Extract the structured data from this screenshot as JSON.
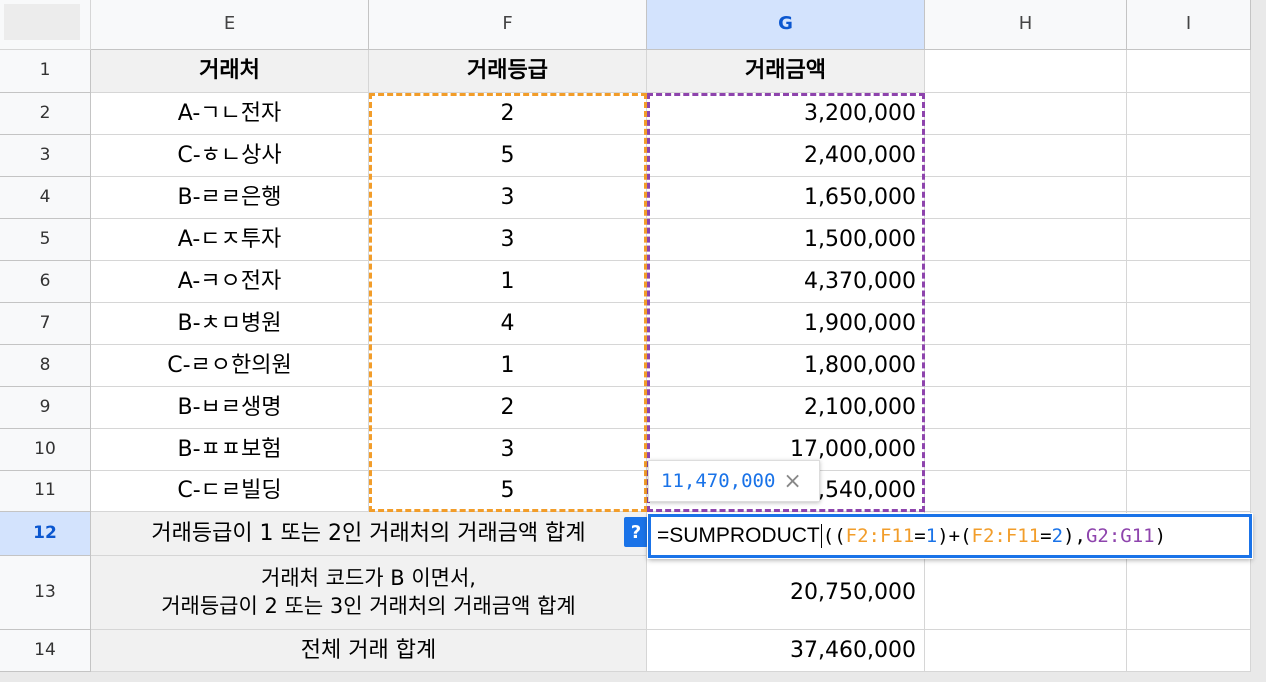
{
  "columns": [
    "E",
    "F",
    "G",
    "H",
    "I"
  ],
  "selected_column": "G",
  "rows": [
    {
      "num": "1",
      "e": "거래처",
      "f": "거래등급",
      "g": "거래금액"
    },
    {
      "num": "2",
      "e": "A-ㄱㄴ전자",
      "f": "2",
      "g": "3,200,000"
    },
    {
      "num": "3",
      "e": "C-ㅎㄴ상사",
      "f": "5",
      "g": "2,400,000"
    },
    {
      "num": "4",
      "e": "B-ㄹㄹ은행",
      "f": "3",
      "g": "1,650,000"
    },
    {
      "num": "5",
      "e": "A-ㄷㅈ투자",
      "f": "3",
      "g": "1,500,000"
    },
    {
      "num": "6",
      "e": "A-ㅋㅇ전자",
      "f": "1",
      "g": "4,370,000"
    },
    {
      "num": "7",
      "e": "B-ㅊㅁ병원",
      "f": "4",
      "g": "1,900,000"
    },
    {
      "num": "8",
      "e": "C-ㄹㅇ한의원",
      "f": "1",
      "g": "1,800,000"
    },
    {
      "num": "9",
      "e": "B-ㅂㄹ생명",
      "f": "2",
      "g": "2,100,000"
    },
    {
      "num": "10",
      "e": "B-ㅍㅍ보험",
      "f": "3",
      "g": "17,000,000"
    },
    {
      "num": "11",
      "e": "C-ㄷㄹ빌딩",
      "f": "5",
      "g": "1,540,000"
    },
    {
      "num": "12",
      "e": "거래등급이 1 또는 2인 거래처의 거래금액 합계",
      "f": "",
      "g": ""
    },
    {
      "num": "13",
      "e": "거래처 코드가 B 이면서,",
      "e2": "거래등급이 2 또는 3인 거래처의 거래금액 합계",
      "f": "",
      "g": "20,750,000"
    },
    {
      "num": "14",
      "e": "전체 거래 합계",
      "f": "",
      "g": "37,460,000"
    }
  ],
  "selected_row": "12",
  "tooltip": {
    "value": "11,470,000",
    "close": "×"
  },
  "help_button": "?",
  "formula": {
    "prefix": "=SUMPRODUCT",
    "open": "((",
    "range1": "F2:F11",
    "eq1": "=",
    "val1": "1",
    "mid": ")+(",
    "range2": "F2:F11",
    "eq2": "=",
    "val2": "2",
    "sep": "),",
    "range3": "G2:G11",
    "close": ")"
  },
  "colors": {
    "range_f": "#f29d2a",
    "range_g": "#8e44ad",
    "number": "#1a73e8",
    "selection": "#1a73e8"
  }
}
